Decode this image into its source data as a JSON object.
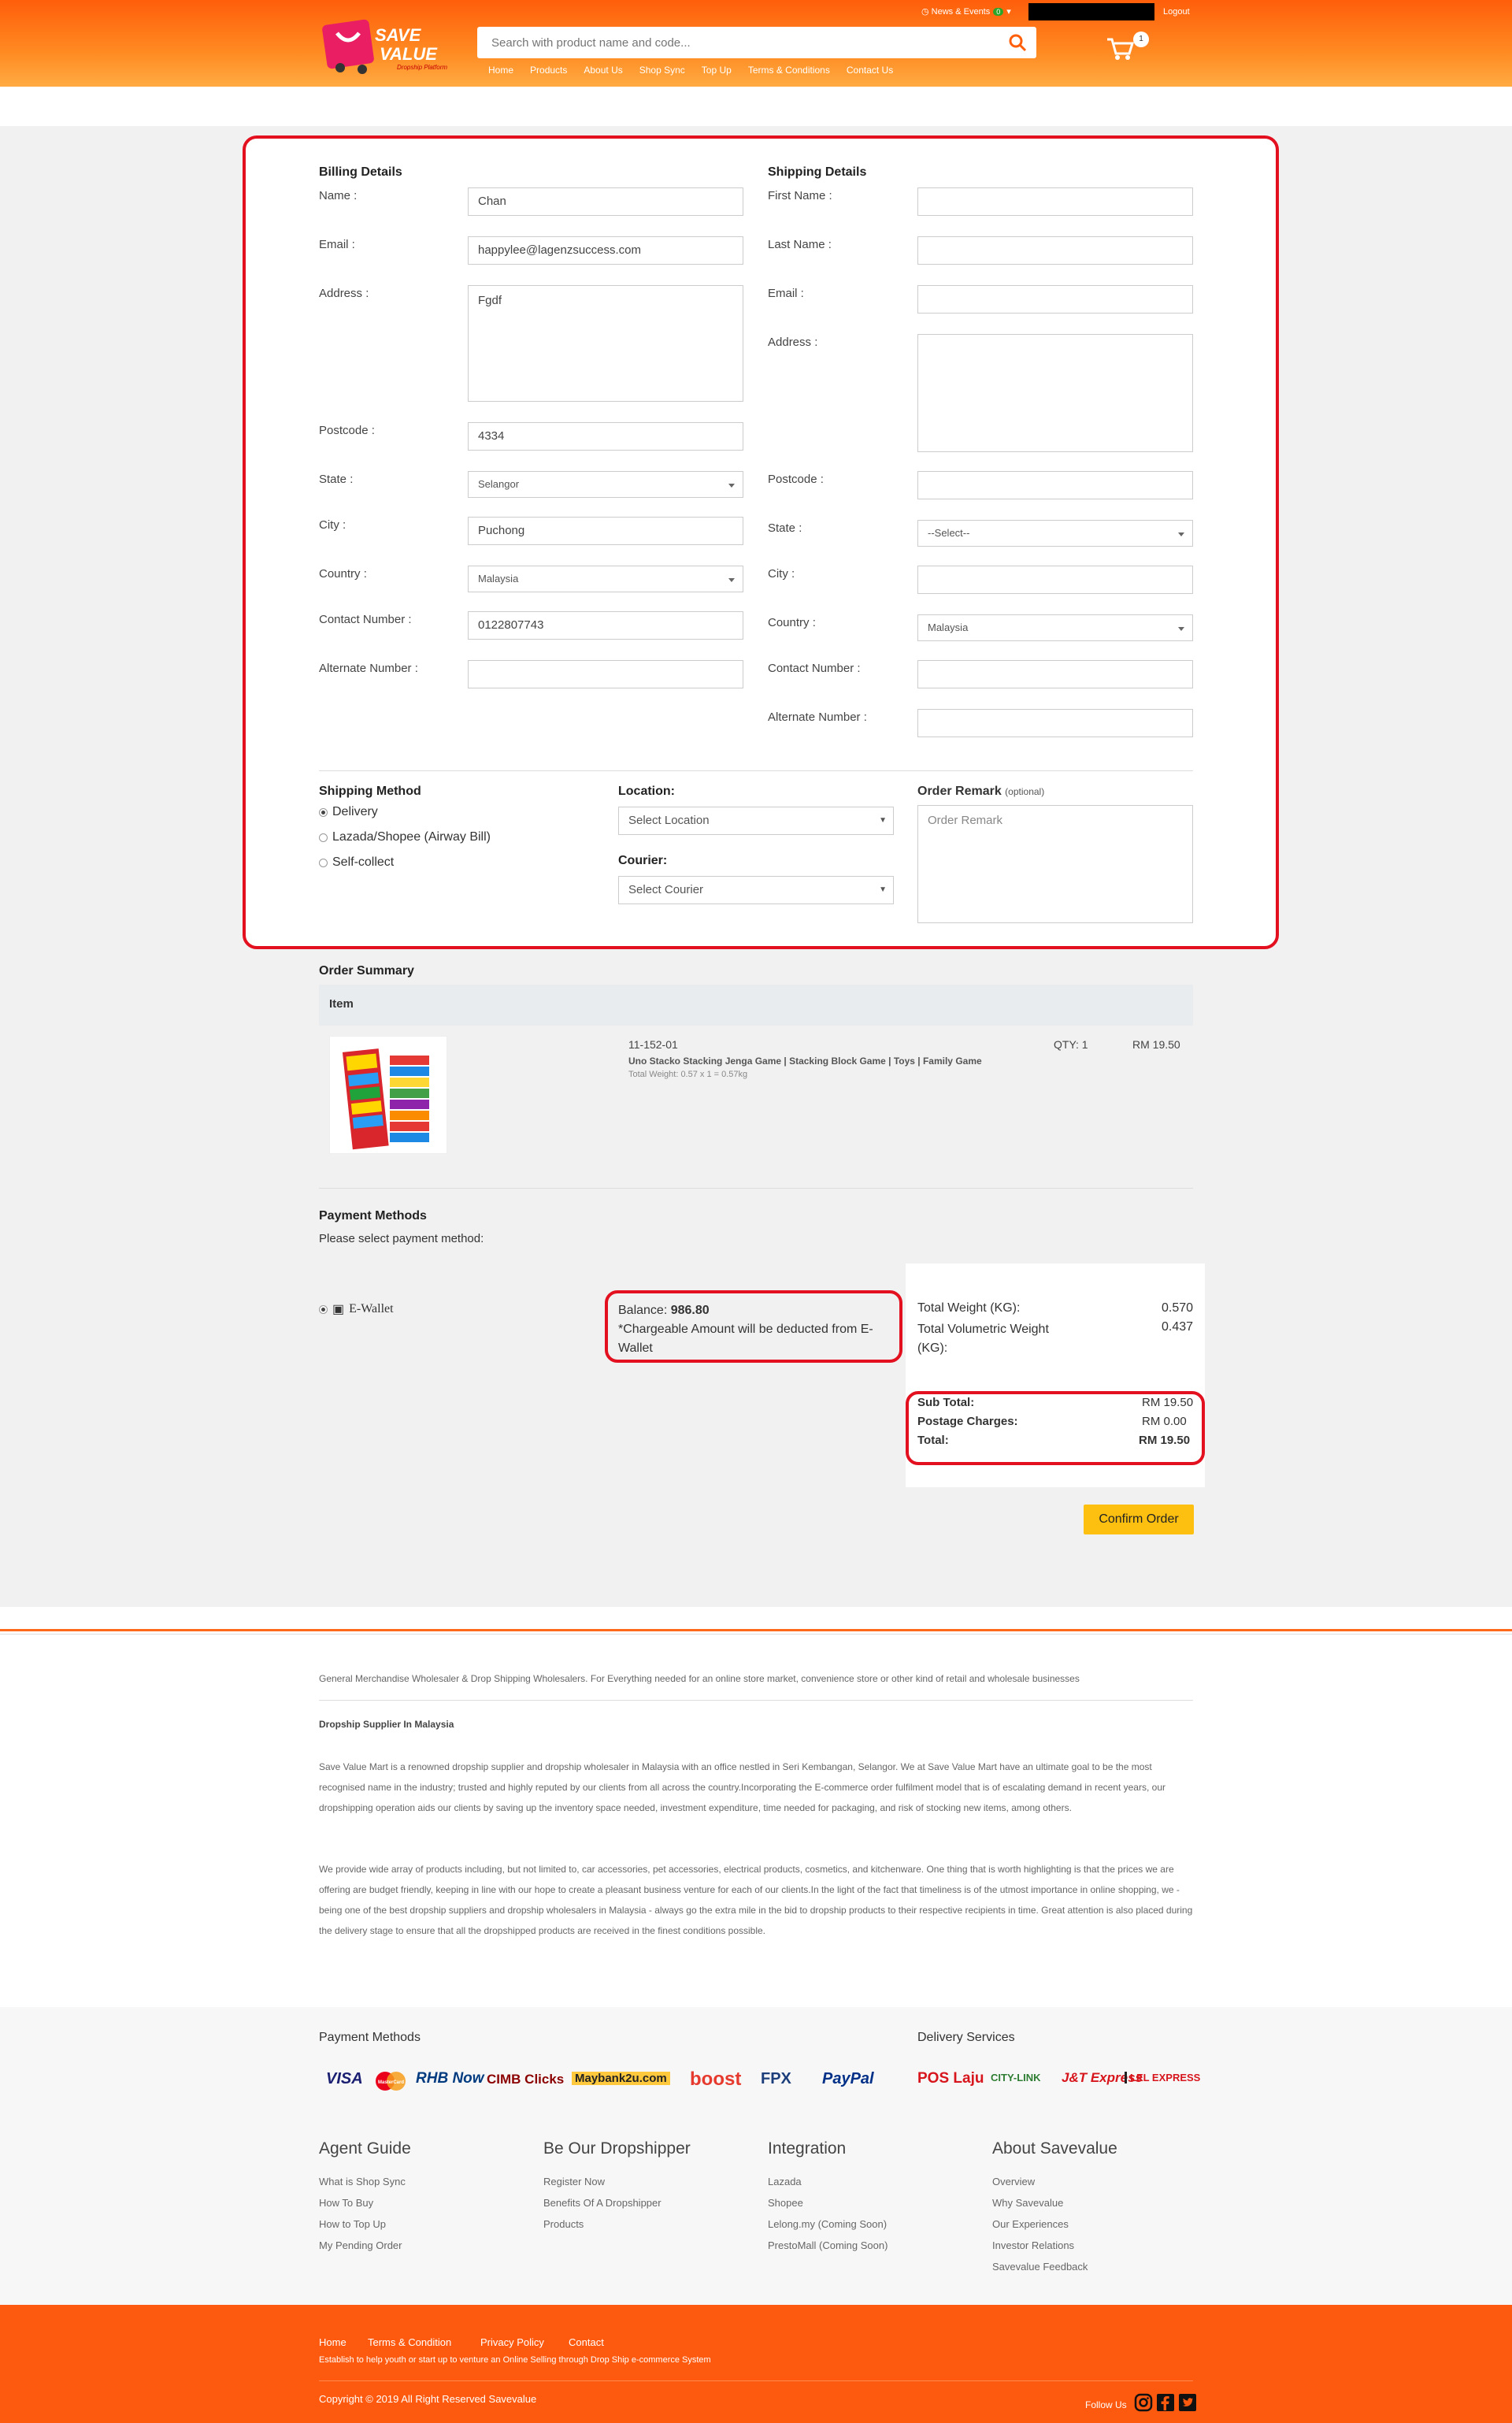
{
  "header": {
    "logo_text_1": "SAVE",
    "logo_text_2": "VALUE",
    "logo_tagline": "Dropship Platform",
    "search_placeholder": "Search with product name and code...",
    "news_label": "News & Events",
    "news_count": "0",
    "logout_label": "Logout",
    "cart_count": "1",
    "nav": [
      "Home",
      "Products",
      "About Us",
      "Shop Sync",
      "Top Up",
      "Terms & Conditions",
      "Contact Us"
    ]
  },
  "billing": {
    "heading": "Billing Details",
    "name_label": "Name :",
    "name_value": "Chan",
    "email_label": "Email :",
    "email_value": "happylee@lagenzsuccess.com",
    "address_label": "Address :",
    "address_value": "Fgdf",
    "postcode_label": "Postcode :",
    "postcode_value": "4334",
    "state_label": "State :",
    "state_value": "Selangor",
    "city_label": "City :",
    "city_value": "Puchong",
    "country_label": "Country :",
    "country_value": "Malaysia",
    "contact_label": "Contact Number :",
    "contact_value": "0122807743",
    "alt_label": "Alternate Number :",
    "alt_value": ""
  },
  "shipping": {
    "heading": "Shipping Details",
    "first_name_label": "First Name :",
    "last_name_label": "Last Name :",
    "email_label": "Email :",
    "address_label": "Address :",
    "postcode_label": "Postcode :",
    "state_label": "State :",
    "state_value": "--Select--",
    "city_label": "City :",
    "country_label": "Country :",
    "country_value": "Malaysia",
    "contact_label": "Contact Number :",
    "alt_label": "Alternate Number :"
  },
  "shipping_method": {
    "heading": "Shipping Method",
    "options": [
      "Delivery",
      "Lazada/Shopee (Airway Bill)",
      "Self-collect"
    ],
    "location_label": "Location:",
    "location_value": "Select Location",
    "courier_label": "Courier:",
    "courier_value": "Select Courier",
    "remark_label": "Order Remark",
    "remark_optional": "(optional)",
    "remark_placeholder": "Order Remark"
  },
  "order_summary": {
    "heading": "Order Summary",
    "item_header": "Item",
    "item_code": "11-152-01",
    "item_name": "Uno Stacko Stacking Jenga Game | Stacking Block Game | Toys | Family Game",
    "item_weight": "Total Weight: 0.57 x 1 = 0.57kg",
    "item_qty": "QTY: 1",
    "item_price": "RM 19.50"
  },
  "payment": {
    "heading": "Payment Methods",
    "instruction": "Please select payment method:",
    "ewallet_label": "E-Wallet",
    "balance_label": "Balance:",
    "balance_value": "986.80",
    "balance_note": "*Chargeable Amount will be deducted from E-Wallet",
    "total_weight_label": "Total Weight (KG):",
    "total_weight_value": "0.570",
    "vol_weight_label": "Total Volumetric Weight (KG):",
    "vol_weight_value": "0.437",
    "subtotal_label": "Sub Total:",
    "subtotal_value": "RM 19.50",
    "postage_label": "Postage Charges:",
    "postage_value": "RM 0.00",
    "total_label": "Total:",
    "total_value": "RM 19.50",
    "confirm_label": "Confirm Order"
  },
  "footer": {
    "tagline": "General Merchandise Wholesaler & Drop Shipping Wholesalers. For Everything needed for an online store market, convenience store or other kind of retail and wholesale businesses",
    "about_heading": "Dropship Supplier In Malaysia",
    "about_p1": "Save Value Mart is a renowned dropship supplier and dropship wholesaler in Malaysia with an office nestled in Seri Kembangan, Selangor. We at Save Value Mart have an ultimate goal to be the most recognised name in the industry; trusted and highly reputed by our clients from all across the country.Incorporating the E-commerce order fulfilment model that is of escalating demand in recent years, our dropshipping operation aids our clients by saving up the inventory space needed, investment expenditure, time needed for packaging, and risk of stocking new items, among others.",
    "about_p2": "We provide wide array of products including, but not limited to, car accessories, pet accessories, electrical products, cosmetics, and kitchenware. One thing that is worth highlighting is that the prices we are offering are budget friendly, keeping in line with our hope to create a pleasant business venture for each of our clients.In the light of the fact that timeliness is of the utmost importance in online shopping, we - being one of the best dropship suppliers and dropship wholesalers in Malaysia - always go the extra mile in the bid to dropship products to their respective recipients in time. Great attention is also placed during the delivery stage to ensure that all the dropshipped products are received in the finest conditions possible.",
    "payment_methods_heading": "Payment Methods",
    "delivery_heading": "Delivery Services",
    "pay_logos": [
      "VISA",
      "MasterCard",
      "RHB Now",
      "CIMB Clicks",
      "Maybank2u.com",
      "boost",
      "FPX",
      "PayPal"
    ],
    "delivery_logos": [
      "POS Laju",
      "CITY-LINK",
      "J&T Express",
      "LEL EXPRESS"
    ],
    "columns": [
      {
        "title": "Agent Guide",
        "links": [
          "What is Shop Sync",
          "How To Buy",
          "How to Top Up",
          "My Pending Order"
        ]
      },
      {
        "title": "Be Our Dropshipper",
        "links": [
          "Register Now",
          "Benefits Of A Dropshipper",
          "Products"
        ]
      },
      {
        "title": "Integration",
        "links": [
          "Lazada",
          "Shopee",
          "Lelong.my (Coming Soon)",
          "PrestoMall (Coming Soon)"
        ]
      },
      {
        "title": "About Savevalue",
        "links": [
          "Overview",
          "Why Savevalue",
          "Our Experiences",
          "Investor Relations",
          "Savevalue Feedback"
        ]
      }
    ],
    "bottom_links": [
      "Home",
      "Terms & Condition",
      "Privacy Policy",
      "Contact"
    ],
    "bottom_tagline": "Establish to help youth or start up to venture an Online Selling through Drop Ship e-commerce System",
    "copyright": "Copyright  ©  2019  All  Right  Reserved  Savevalue",
    "follow_us": "Follow Us"
  },
  "colors": {
    "brand_orange": "#fd5a0f",
    "highlight_red": "#e3101f",
    "confirm_yellow": "#fdc010"
  }
}
